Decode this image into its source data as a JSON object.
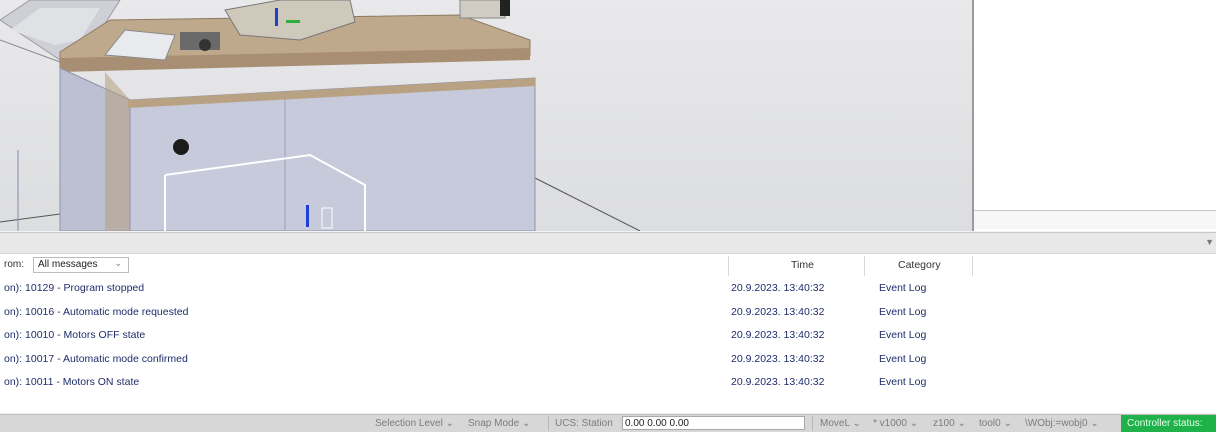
{
  "output": {
    "filter_label": "rom:",
    "filter_value": "All messages",
    "columns": {
      "time": "Time",
      "category": "Category"
    },
    "rows": [
      {
        "message": "on): 10129 - Program stopped",
        "time": "20.9.2023. 13:40:32",
        "category": "Event Log"
      },
      {
        "message": "on): 10016 - Automatic mode requested",
        "time": "20.9.2023. 13:40:32",
        "category": "Event Log"
      },
      {
        "message": "on): 10010 - Motors OFF state",
        "time": "20.9.2023. 13:40:32",
        "category": "Event Log"
      },
      {
        "message": "on): 10017 - Automatic mode confirmed",
        "time": "20.9.2023. 13:40:32",
        "category": "Event Log"
      },
      {
        "message": "on): 10011 - Motors ON state",
        "time": "20.9.2023. 13:40:32",
        "category": "Event Log"
      }
    ]
  },
  "statusbar": {
    "selection_level": "Selection Level",
    "snap_mode": "Snap Mode",
    "ucs": "UCS: Station",
    "coords": "0.00 0.00 0.00",
    "move": "MoveL",
    "speed": "v1000",
    "zone": "z100",
    "tool": "tool0",
    "wobj": "\\WObj:=wobj0",
    "controller_status": "Controller status:"
  },
  "icons": {
    "dropdown": "chevron-down-icon",
    "collapse": "collapse-arrow-icon"
  },
  "colors": {
    "controller_status_bg": "#1fb24a",
    "text_blue": "#1f2d6b"
  }
}
